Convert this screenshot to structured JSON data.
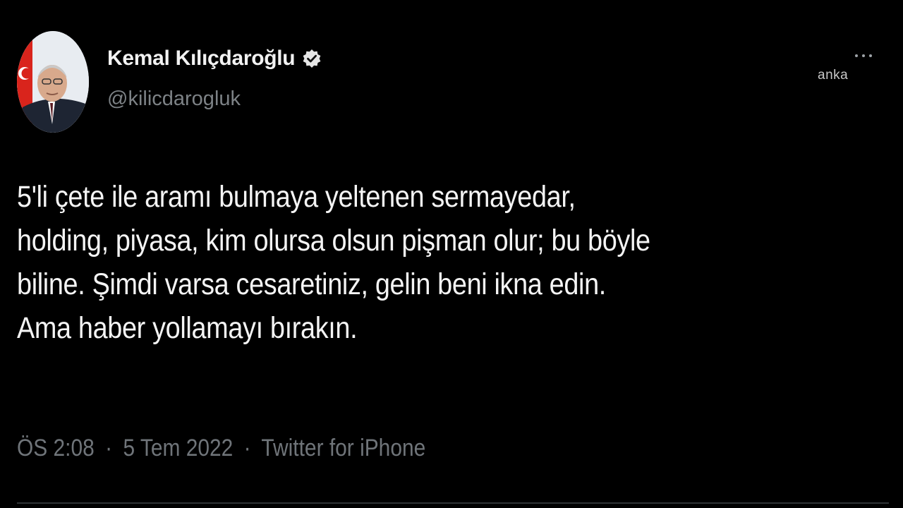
{
  "author": {
    "name": "Kemal Kılıçdaroğlu",
    "handle": "@kilicdarogluk",
    "verified_icon": "verified-badge-icon",
    "avatar_icon": "profile-photo"
  },
  "tweet": {
    "text": "5'li çete ile aramı bulmaya yeltenen sermayedar,\nholding, piyasa, kim olursa olsun pişman olur; bu böyle\nbiline. Şimdi varsa cesaretiniz, gelin beni ikna edin.\nAma haber yollamayı bırakın."
  },
  "meta": {
    "time": "ÖS 2:08",
    "date": "5 Tem 2022",
    "source": "Twitter for iPhone",
    "separator": "·"
  },
  "watermark": {
    "text": "anka"
  },
  "colors": {
    "background": "#000000",
    "text": "#f4f4f4",
    "secondary": "#71767b"
  }
}
